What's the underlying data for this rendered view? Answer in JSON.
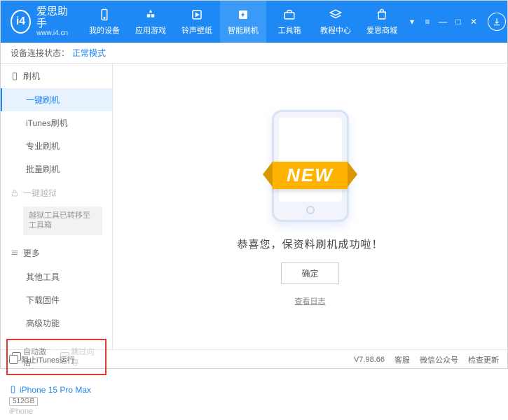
{
  "logo": {
    "mark": "i4",
    "title": "爱思助手",
    "url": "www.i4.cn"
  },
  "nav": [
    {
      "id": "device",
      "label": "我的设备"
    },
    {
      "id": "apps",
      "label": "应用游戏"
    },
    {
      "id": "media",
      "label": "铃声壁纸"
    },
    {
      "id": "flash",
      "label": "智能刷机",
      "active": true
    },
    {
      "id": "tools",
      "label": "工具箱"
    },
    {
      "id": "tutorial",
      "label": "教程中心"
    },
    {
      "id": "store",
      "label": "爱思商城"
    }
  ],
  "status": {
    "label": "设备连接状态：",
    "mode": "正常模式"
  },
  "sidebar": {
    "group_flash": "刷机",
    "items_flash": [
      {
        "label": "一键刷机",
        "active": true
      },
      {
        "label": "iTunes刷机"
      },
      {
        "label": "专业刷机"
      },
      {
        "label": "批量刷机"
      }
    ],
    "group_jailbreak": "一键越狱",
    "jailbreak_note": "越狱工具已转移至工具箱",
    "group_more": "更多",
    "items_more": [
      {
        "label": "其他工具"
      },
      {
        "label": "下载固件"
      },
      {
        "label": "高级功能"
      }
    ],
    "check_auto_activate": "自动激活",
    "check_skip_wizard": "跳过向导"
  },
  "device": {
    "name": "iPhone 15 Pro Max",
    "capacity": "512GB",
    "model": "iPhone"
  },
  "main": {
    "banner": "NEW",
    "message": "恭喜您，保资料刷机成功啦！",
    "ok": "确定",
    "view_log": "查看日志"
  },
  "footer": {
    "block_itunes": "阻止iTunes运行",
    "version": "V7.98.66",
    "support": "客服",
    "wechat": "微信公众号",
    "update": "检查更新"
  }
}
